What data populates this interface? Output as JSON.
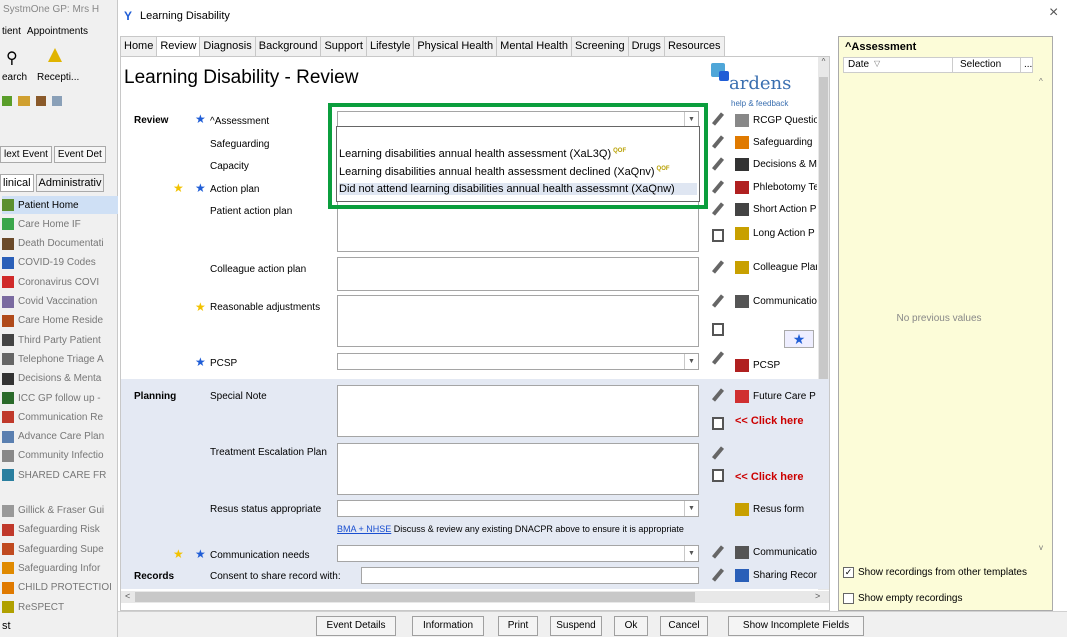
{
  "left_panel": {
    "app_title": "SystmOne GP: Mrs H",
    "menu": [
      "tient",
      "Appointments"
    ],
    "toolbar_labels": [
      "earch",
      "Recepti..."
    ],
    "event_buttons": [
      "lext Event",
      "Event Det"
    ],
    "panel_tabs": [
      "linical",
      "Administrativ"
    ],
    "items": [
      {
        "label": "Patient Home",
        "color": "#5c8f2e"
      },
      {
        "label": "Care Home IF",
        "color": "#3aa64a"
      },
      {
        "label": "Death Documentati",
        "color": "#6b4a2a"
      },
      {
        "label": "COVID-19 Codes",
        "color": "#2a5fb8"
      },
      {
        "label": "Coronavirus COVI",
        "color": "#d02a2a"
      },
      {
        "label": "Covid Vaccination",
        "color": "#7a6aa0"
      },
      {
        "label": "Care Home Reside",
        "color": "#b04a1a"
      },
      {
        "label": "Third Party Patient",
        "color": "#444444"
      },
      {
        "label": "Telephone Triage A",
        "color": "#666666"
      },
      {
        "label": "Decisions & Menta",
        "color": "#333333"
      },
      {
        "label": "ICC GP follow up -",
        "color": "#2a6a2a"
      },
      {
        "label": "Communication Re",
        "color": "#c0392b"
      },
      {
        "label": "Advance Care Plan",
        "color": "#5a7fb0"
      },
      {
        "label": "Community Infectio",
        "color": "#888888"
      },
      {
        "label": "SHARED CARE FR",
        "color": "#2a7f9f"
      },
      {
        "label": "Gillick & Fraser Gui",
        "color": "#999999"
      },
      {
        "label": "Safeguarding Risk",
        "color": "#c0392b"
      },
      {
        "label": "Safeguarding Supe",
        "color": "#c04a20"
      },
      {
        "label": "Safeguarding Infor",
        "color": "#e08a00"
      },
      {
        "label": "CHILD PROTECTIOI",
        "color": "#e07a00"
      },
      {
        "label": "ReSPECT",
        "color": "#b0a000"
      }
    ],
    "status": "st"
  },
  "window": {
    "title": "Learning Disability",
    "close": "×"
  },
  "tabs": [
    "Home",
    "Review",
    "Diagnosis",
    "Background",
    "Support",
    "Lifestyle",
    "Physical Health",
    "Mental Health",
    "Screening",
    "Drugs",
    "Resources"
  ],
  "active_tab": "Review",
  "form": {
    "heading": "Learning Disability - Review",
    "logo": {
      "name": "ardens",
      "sub": "help & feedback"
    },
    "sections": {
      "review": "Review",
      "planning": "Planning",
      "records": "Records"
    },
    "labels": {
      "assessment": "^Assessment",
      "safeguarding": "Safeguarding",
      "capacity": "Capacity",
      "action_plan": "Action plan",
      "patient_action_plan": "Patient action plan",
      "colleague_action_plan": "Colleague action plan",
      "reasonable_adjustments": "Reasonable adjustments",
      "pcsp": "PCSP",
      "special_note": "Special Note",
      "treatment_escalation_plan": "Treatment Escalation Plan",
      "resus_status": "Resus status appropriate",
      "communication_needs": "Communication needs",
      "consent": "Consent to share record with:"
    },
    "dropdown_options": [
      "Learning disabilities annual health assessment (XaL3Q)",
      "Learning disabilities annual health assessment declined (XaQnv)",
      "Did not attend learning disabilities annual health assessmnt (XaQnw)"
    ],
    "qof_badge": "QOF",
    "guidance": {
      "link": "BMA + NHSE",
      "text": "Discuss & review any existing DNACPR above to ensure it is appropriate"
    },
    "side_buttons": {
      "rcgp": "RCGP Questio",
      "safeguarding": "Safeguarding",
      "decisions": "Decisions & M",
      "phlebotomy": "Phlebotomy Te",
      "short_action": "Short Action P",
      "long_action": "Long Action P",
      "colleague_plan": "Colleague Plar",
      "communication1": "Communicatio",
      "pcsp": "PCSP",
      "future_care": "Future Care P",
      "click_here1": "<< Click here",
      "click_here2": "<< Click here",
      "resus_form": "Resus form",
      "communication2": "Communicatio",
      "sharing": "Sharing Recor"
    }
  },
  "right_panel": {
    "title": "^Assessment",
    "col_date": "Date",
    "col_selection": "Selection",
    "col_more": "...",
    "empty": "No previous values",
    "chk1": {
      "label": "Show recordings from other templates",
      "checked": true
    },
    "chk2": {
      "label": "Show empty recordings",
      "checked": false
    }
  },
  "bottom_buttons": [
    "Event Details",
    "Information",
    "Print",
    "Suspend",
    "Ok",
    "Cancel",
    "Show Incomplete Fields"
  ],
  "colors": {
    "accent": "#1f5dd6",
    "highlight_box": "#0b9e3d",
    "right_panel_bg": "#fcfcd8",
    "planning_bg": "#e4e9f3"
  }
}
